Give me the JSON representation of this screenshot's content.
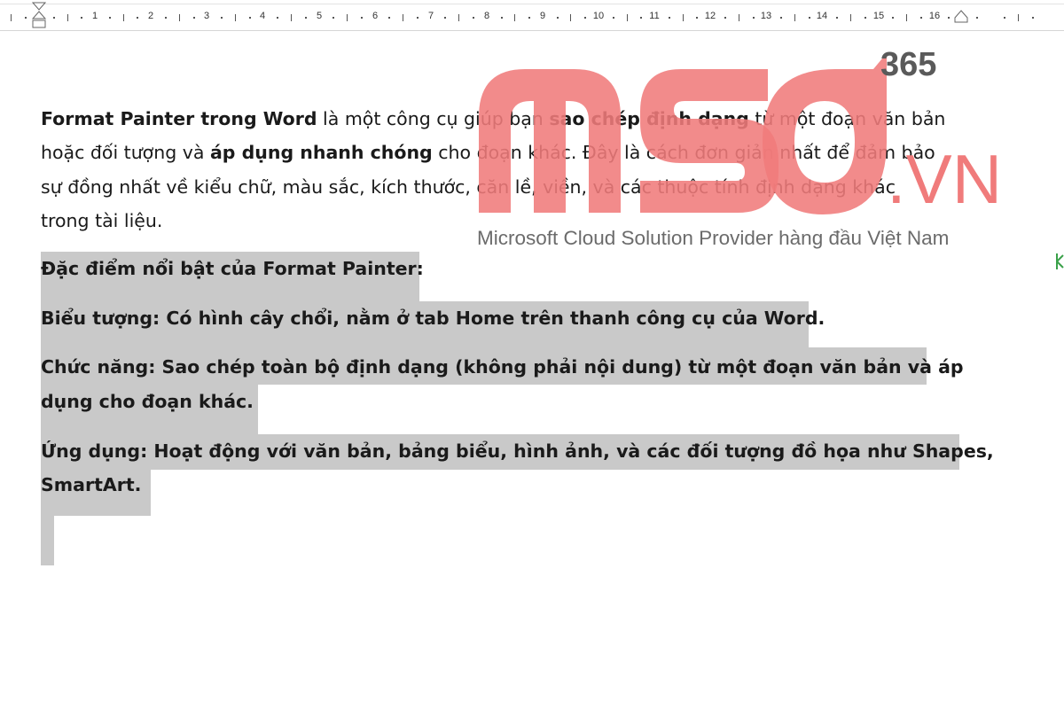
{
  "ruler": {
    "numbers": [
      "1",
      "2",
      "3",
      "4",
      "5",
      "6",
      "7",
      "8",
      "9",
      "10",
      "11",
      "12",
      "13",
      "14",
      "15",
      "16"
    ]
  },
  "intro": {
    "line1_bold1": "Format Painter trong Word",
    "line1_text1": " là một công cụ giúp bạn ",
    "line1_bold2": "sao chép định dạng",
    "line1_text2": " từ một đoạn văn bản",
    "line2_text1": "hoặc đối tượng và ",
    "line2_bold": "áp dụng nhanh chóng",
    "line2_text2": " cho đoạn khác. Đây là cách đơn giản nhất để đảm bảo",
    "line3": "sự đồng nhất về kiểu chữ, màu sắc, kích thước, căn lề, viền, và các thuộc tính định dạng khác",
    "line4": "trong tài liệu."
  },
  "selected": {
    "heading": "Đặc điểm nổi bật của Format Painter:",
    "icon_line": "Biểu tượng: Có hình cây chổi, nằm ở tab Home trên thanh công cụ của Word.",
    "function_line1": "Chức năng: Sao chép toàn bộ định dạng (không phải nội dung) từ một đoạn văn bản và áp",
    "function_line2": "dụng cho đoạn khác.",
    "usage_line1": "Ứng dụng: Hoạt động với văn bản, bảng biểu, hình ảnh, và các đối tượng đồ họa như Shapes,",
    "usage_line2": "SmartArt."
  },
  "watermark": {
    "logo_text": "MSO",
    "number": "365",
    "domain": ".VN",
    "tagline": "Microsoft Cloud Solution Provider hàng đầu Việt Nam",
    "color": "#f07b7b"
  },
  "colors": {
    "selection": "#c9c9c9",
    "text": "#1a1a1a"
  }
}
